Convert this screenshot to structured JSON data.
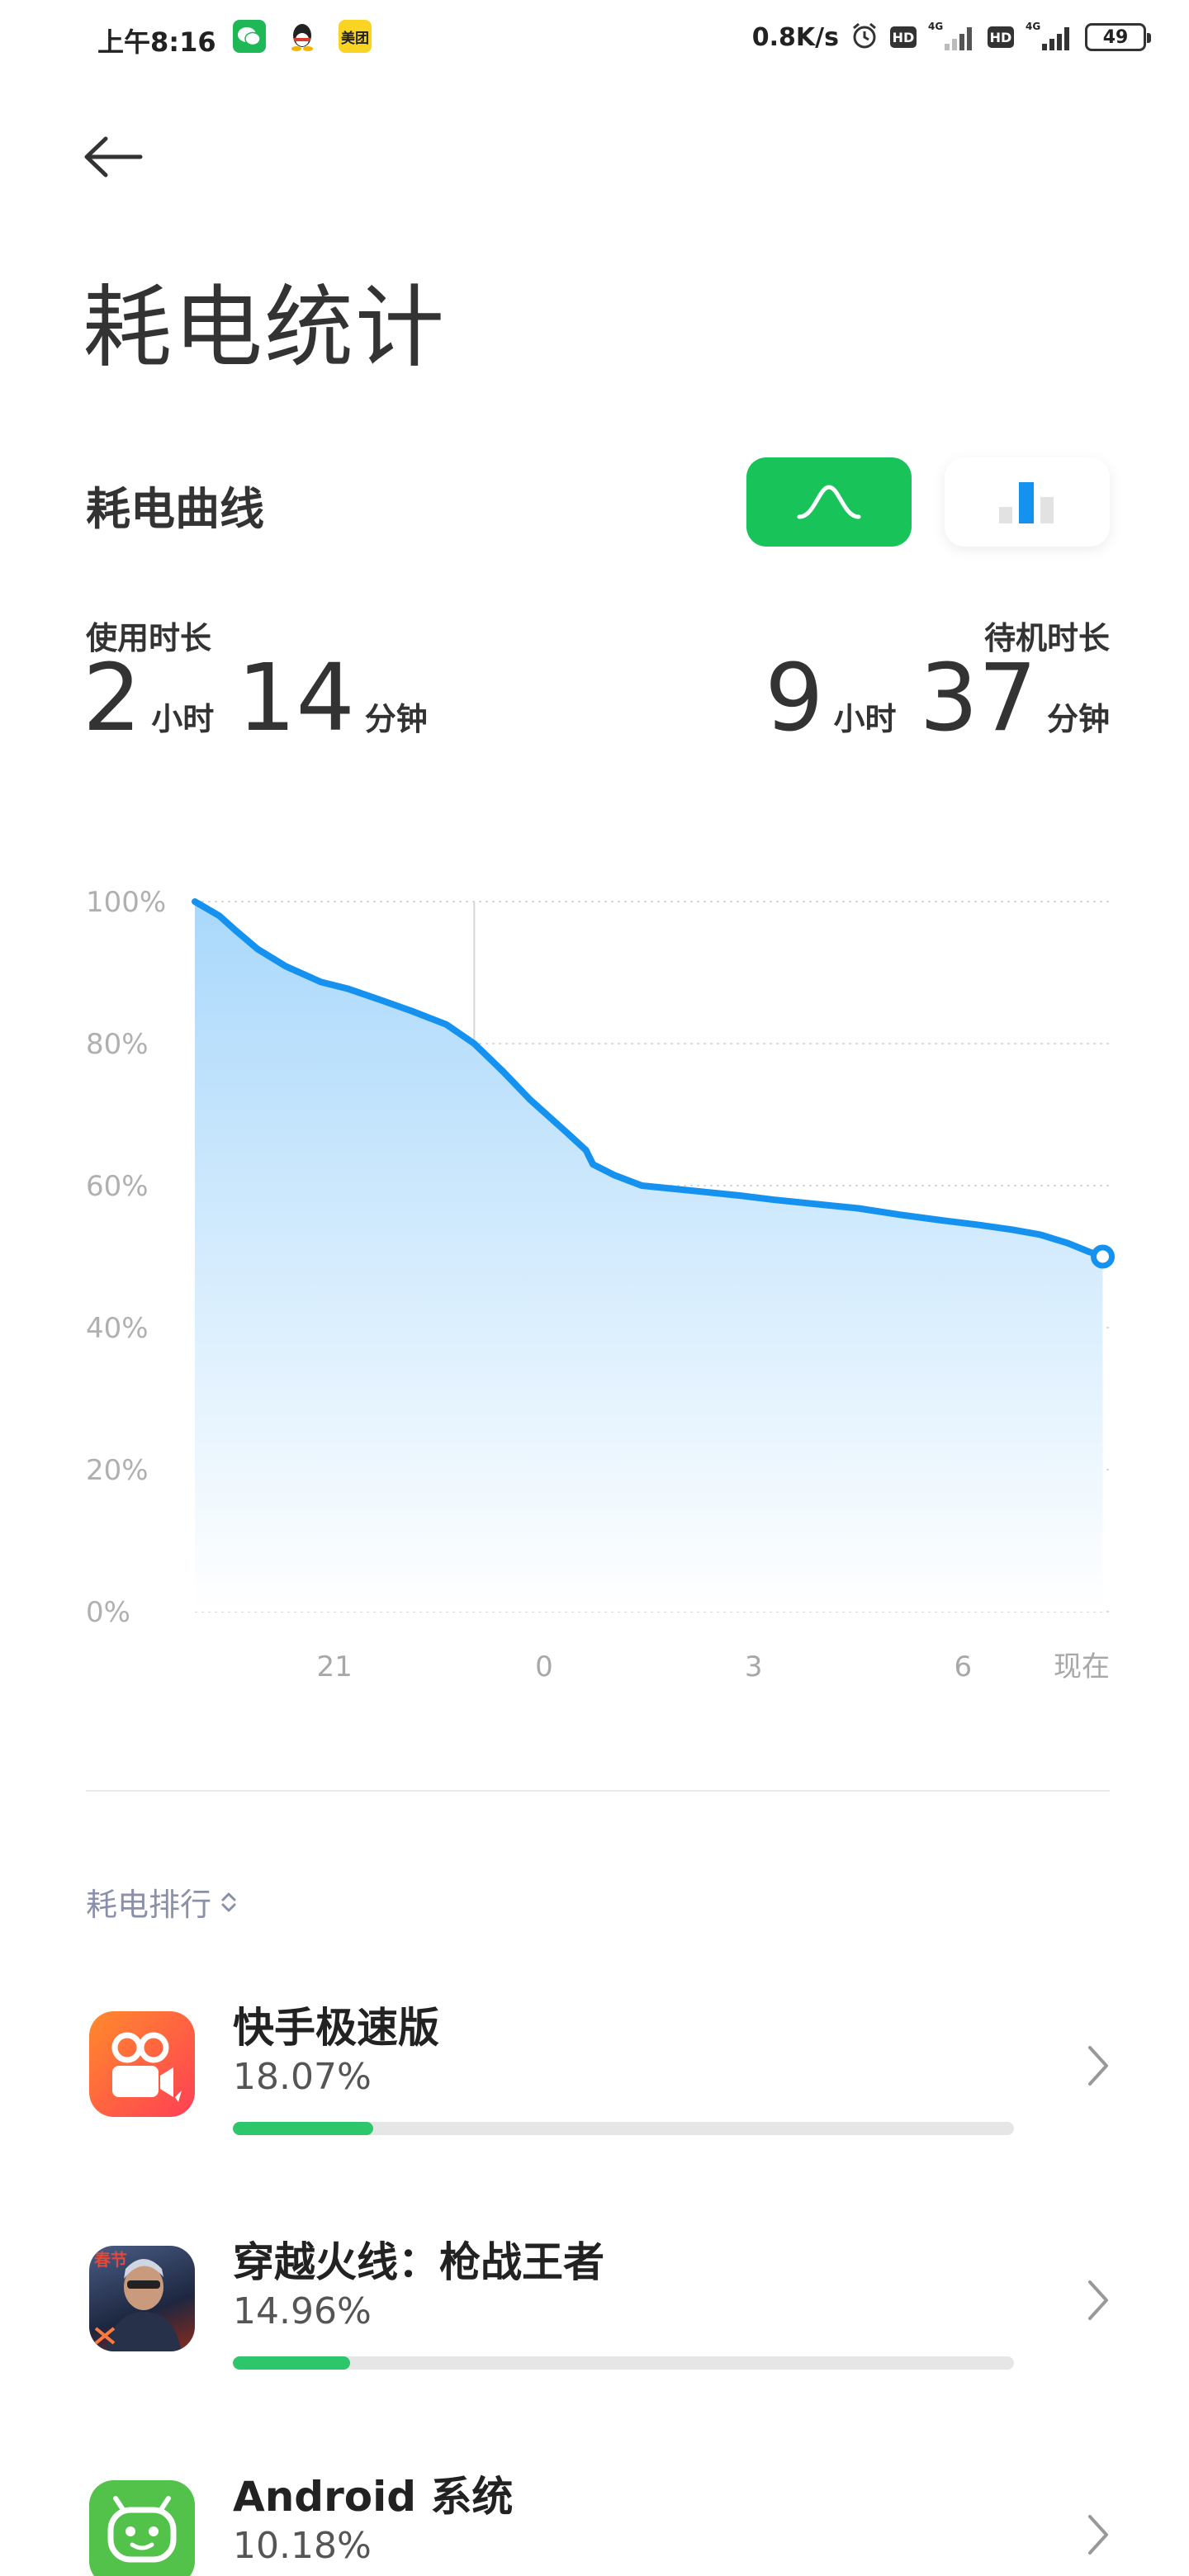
{
  "status_bar": {
    "time": "上午8:16",
    "notif_icons": [
      "wechat-icon",
      "qq-icon",
      "meituan-icon"
    ],
    "meituan_label": "美团",
    "net_speed": "0.8K/s",
    "hd1": "HD",
    "hd2": "HD",
    "net1": "4G",
    "net2": "4G",
    "battery": "49"
  },
  "header": {
    "title": "耗电统计"
  },
  "curve_section": {
    "title": "耗电曲线",
    "toggle_curve_icon": "wave-icon",
    "toggle_bar_icon": "bar-chart-icon"
  },
  "usage": {
    "label": "使用时长",
    "hours": "2",
    "hours_unit": "小时",
    "minutes": "14",
    "minutes_unit": "分钟"
  },
  "standby": {
    "label": "待机时长",
    "hours": "9",
    "hours_unit": "小时",
    "minutes": "37",
    "minutes_unit": "分钟"
  },
  "chart_data": {
    "type": "area",
    "y_ticks": [
      "100%",
      "80%",
      "60%",
      "40%",
      "20%",
      "0%"
    ],
    "ylim": [
      0,
      100
    ],
    "x_ticks": [
      "21",
      "0",
      "3",
      "6",
      "现在"
    ],
    "xlim": [
      19,
      32.1
    ],
    "marker_x": 23,
    "series": [
      {
        "x": [
          19.0,
          19.35,
          19.6,
          19.9,
          20.3,
          20.8,
          21.2,
          21.7,
          22.1,
          22.6,
          23.0,
          23.4,
          23.8,
          24.3,
          24.6,
          24.7,
          25.0,
          25.4,
          25.8,
          26.3,
          26.8,
          27.3,
          27.9,
          28.5,
          29.1,
          29.7,
          30.2,
          30.7,
          31.1,
          31.5,
          31.8,
          32.0
        ],
        "values": [
          100,
          98,
          95.8,
          93.3,
          90.9,
          88.7,
          87.7,
          86,
          84.6,
          82.7,
          80,
          76.2,
          72.1,
          67.7,
          65,
          63,
          61.5,
          60,
          59.6,
          59.1,
          58.6,
          58,
          57.4,
          56.8,
          55.9,
          55.1,
          54.5,
          53.8,
          53.1,
          51.9,
          50.7,
          50
        ]
      }
    ],
    "line_color": "#1592ef",
    "fill_top_color": "#a9d8fb",
    "fill_bottom_color": "#ffffff",
    "grid": true
  },
  "ranking": {
    "sort_label": "耗电排行",
    "apps": [
      {
        "name": "快手极速版",
        "percent": "18.07%",
        "fraction": 0.18,
        "icon": "kuaishou-icon"
      },
      {
        "name": "穿越火线：枪战王者",
        "percent": "14.96%",
        "fraction": 0.15,
        "icon": "crossfire-icon"
      },
      {
        "name": "Android 系统",
        "percent": "10.18%",
        "fraction": 0.1,
        "icon": "android-icon"
      }
    ]
  },
  "colors": {
    "accent_green": "#18c45a",
    "progress_green": "#2ec66b",
    "chart_blue": "#1592ef"
  }
}
